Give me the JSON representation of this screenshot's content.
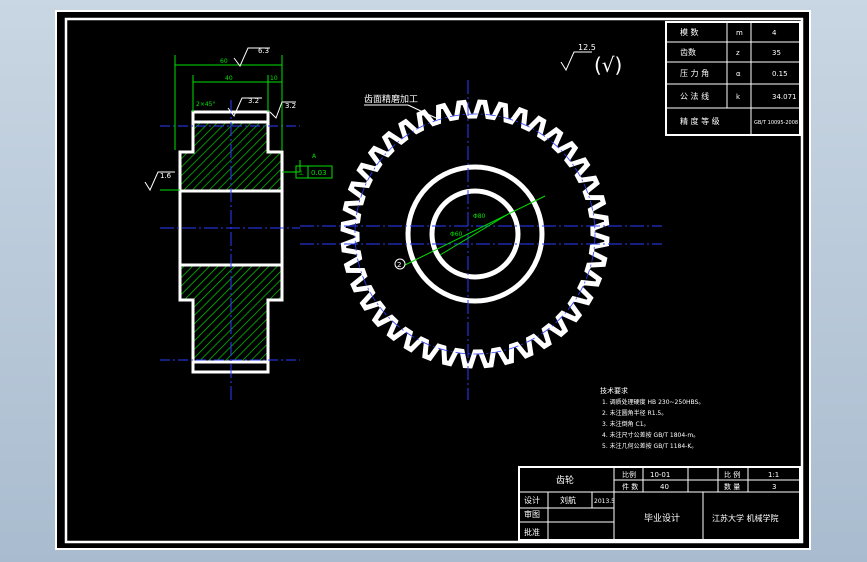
{
  "drawing": {
    "title_block": {
      "part_name": "齿轮",
      "label_material": "比例",
      "material": "10-01",
      "label_scale": "比 例",
      "scale": "1:1",
      "label_qty_sheet": "件 数",
      "qty_sheet": "40",
      "label_weight": "数 量",
      "weight": "3",
      "label_designer": "设计",
      "designer": "刘航",
      "date": "2013.5",
      "label_checker": "审图",
      "label_approver": "批准",
      "project": "毕业设计",
      "school": "江苏大学 机械学院"
    },
    "param_table": [
      {
        "name": "模 数",
        "symbol": "m",
        "value": "4"
      },
      {
        "name": "齿数",
        "symbol": "z",
        "value": "35"
      },
      {
        "name": "压 力 角",
        "symbol": "α",
        "value": "0.15"
      },
      {
        "name": "公 法 线",
        "symbol": "k",
        "value": "34.071"
      },
      {
        "name": "精 度 等 级",
        "symbol": "",
        "value": "GB/T 10095-2008"
      }
    ],
    "roughness_general": "12.5",
    "roughness_general_paren": "(√)",
    "tooth_note": "齿面精磨加工",
    "tech_requirements_title": "技术要求",
    "tech_requirements": [
      "1. 调质处理硬度 HB 230~250HBS。",
      "2. 未注圆角半径 R1.5。",
      "3. 未注倒角 C1。",
      "4. 未注尺寸公差按 GB/T 1804-m。",
      "5. 未注几何公差按 GB/T 1184-K。"
    ],
    "dims": {
      "rough_top": "6.3",
      "rough_mid": "3.2",
      "rough_right": "3.2",
      "rough_left": "1.6",
      "width_total": "60",
      "width_mid": "40",
      "width_right": "10",
      "chamfer": "2×45°",
      "tolerance_frame": "0.03",
      "tolerance_symbol": "⊥",
      "datum_label": "A",
      "bore_dia": "Φ60",
      "hub_dia": "Φ80"
    }
  }
}
